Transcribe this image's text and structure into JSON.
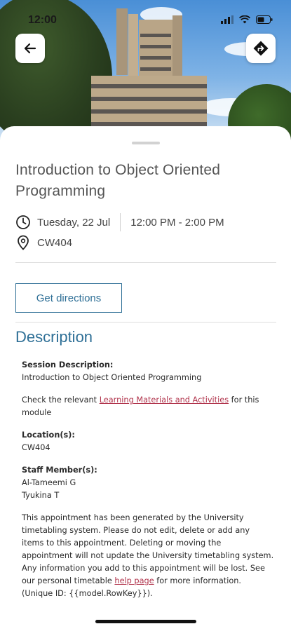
{
  "status_bar": {
    "time": "12:00"
  },
  "header": {
    "back_button_label": "Back",
    "directions_button_label": "Directions"
  },
  "event": {
    "title": "Introduction to Object Oriented Programming",
    "date": "Tuesday, 22 Jul",
    "time_range": "12:00 PM - 2:00 PM",
    "location": "CW404"
  },
  "actions": {
    "get_directions": "Get directions"
  },
  "description": {
    "heading": "Description",
    "session_label": "Session Description:",
    "session_value": "Introduction to Object Oriented Programming",
    "materials_prefix": "Check the relevant ",
    "materials_link": "Learning Materials and Activities",
    "materials_suffix": " for this module",
    "location_label": "Location(s):",
    "location_value": "CW404",
    "staff_label": "Staff Member(s):",
    "staff": [
      "Al-Tameemi G",
      "Tyukina T"
    ],
    "notice_text": "This appointment has been generated by the University timetabling system. Please do not edit, delete or add any items to this appointment. Deleting or moving the appointment will not update the University timetabling system. Any information you add to this appointment will be lost. See our personal timetable ",
    "help_link": "help page",
    "notice_suffix": " for more information. (Unique ID: {{model.RowKey}})."
  },
  "colors": {
    "accent": "#2e6f96",
    "link": "#b0324a",
    "title_text": "#555555"
  },
  "icons": {
    "back": "arrow-left-icon",
    "directions": "turn-right-diamond-icon",
    "clock": "clock-icon",
    "location": "map-pin-icon",
    "signal": "signal-icon",
    "wifi": "wifi-icon",
    "battery": "battery-icon"
  }
}
